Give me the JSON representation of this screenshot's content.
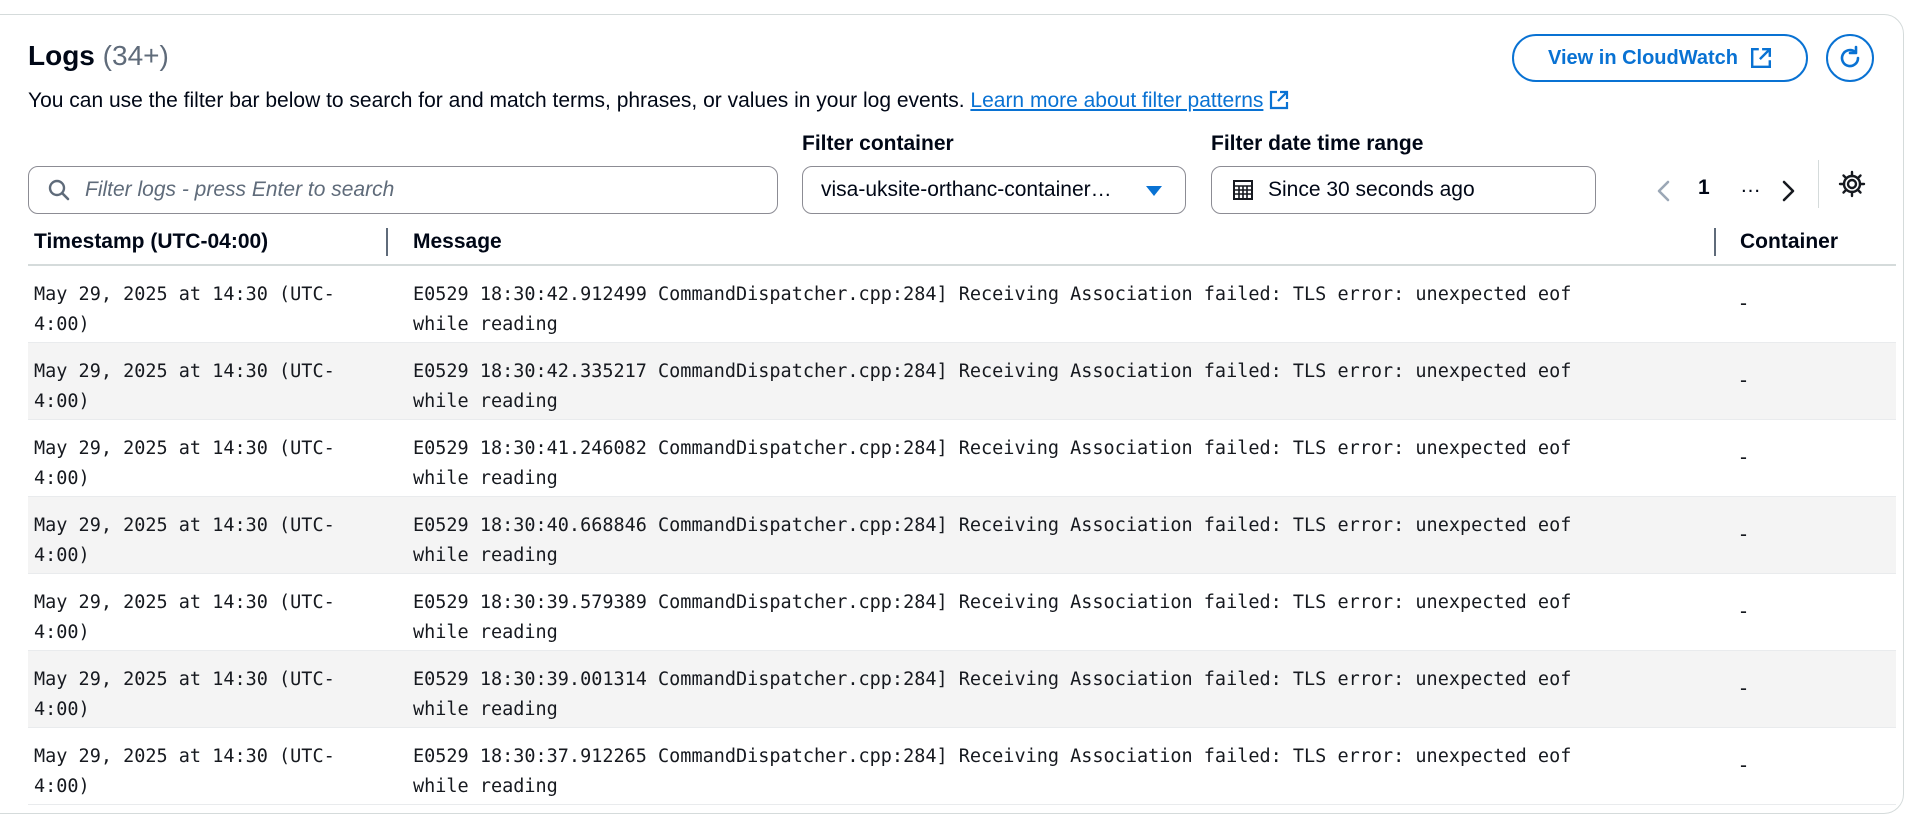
{
  "header": {
    "title": "Logs",
    "count": "(34+)",
    "description": "You can use the filter bar below to search for and match terms, phrases, or values in your log events.",
    "learn_more_link": "Learn more about filter patterns",
    "view_button": "View in CloudWatch"
  },
  "filters": {
    "search_placeholder": "Filter logs - press Enter to search",
    "container_label": "Filter container",
    "container_value": "visa-uksite-orthanc-container…",
    "date_label": "Filter date time range",
    "date_value": "Since 30 seconds ago"
  },
  "pagination": {
    "current_page": "1",
    "ellipsis": "…"
  },
  "table": {
    "columns": {
      "timestamp": "Timestamp (UTC-04:00)",
      "message": "Message",
      "container": "Container"
    },
    "rows": [
      {
        "timestamp": "May 29, 2025 at 14:30 (UTC-\n4:00)",
        "message": "E0529 18:30:42.912499 CommandDispatcher.cpp:284] Receiving Association failed: TLS error: unexpected eof while reading",
        "container": "-"
      },
      {
        "timestamp": "May 29, 2025 at 14:30 (UTC-\n4:00)",
        "message": "E0529 18:30:42.335217 CommandDispatcher.cpp:284] Receiving Association failed: TLS error: unexpected eof while reading",
        "container": "-"
      },
      {
        "timestamp": "May 29, 2025 at 14:30 (UTC-\n4:00)",
        "message": "E0529 18:30:41.246082 CommandDispatcher.cpp:284] Receiving Association failed: TLS error: unexpected eof while reading",
        "container": "-"
      },
      {
        "timestamp": "May 29, 2025 at 14:30 (UTC-\n4:00)",
        "message": "E0529 18:30:40.668846 CommandDispatcher.cpp:284] Receiving Association failed: TLS error: unexpected eof while reading",
        "container": "-"
      },
      {
        "timestamp": "May 29, 2025 at 14:30 (UTC-\n4:00)",
        "message": "E0529 18:30:39.579389 CommandDispatcher.cpp:284] Receiving Association failed: TLS error: unexpected eof while reading",
        "container": "-"
      },
      {
        "timestamp": "May 29, 2025 at 14:30 (UTC-\n4:00)",
        "message": "E0529 18:30:39.001314 CommandDispatcher.cpp:284] Receiving Association failed: TLS error: unexpected eof while reading",
        "container": "-"
      },
      {
        "timestamp": "May 29, 2025 at 14:30 (UTC-\n4:00)",
        "message": "E0529 18:30:37.912265 CommandDispatcher.cpp:284] Receiving Association failed: TLS error: unexpected eof while reading",
        "container": "-"
      }
    ]
  },
  "icons": {
    "search": "search-icon",
    "caret": "caret-down-icon",
    "calendar": "calendar-icon",
    "external": "external-link-icon",
    "refresh": "refresh-icon",
    "prev": "chevron-left-icon",
    "next": "chevron-right-icon",
    "settings": "gear-icon"
  },
  "colors": {
    "accent": "#0972d3",
    "text": "#000716",
    "muted": "#5f6b7a",
    "row_alt": "#f4f4f4"
  }
}
